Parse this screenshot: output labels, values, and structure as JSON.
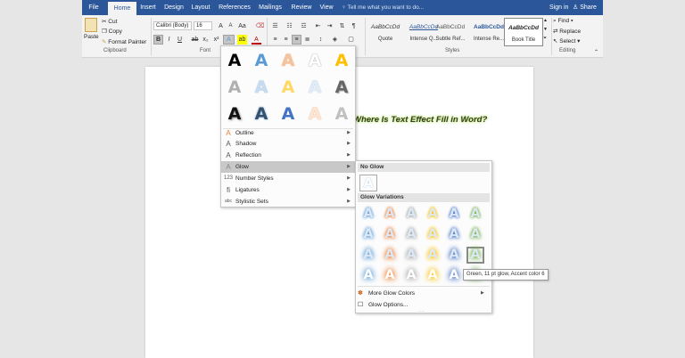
{
  "tabs": [
    "File",
    "Home",
    "Insert",
    "Design",
    "Layout",
    "References",
    "Mailings",
    "Review",
    "View"
  ],
  "tell_me": "Tell me what you want to do...",
  "sign_in": "Sign in",
  "share": "Share",
  "clipboard": {
    "paste": "Paste",
    "cut": "Cut",
    "copy": "Copy",
    "format_painter": "Format Painter",
    "label": "Clipboard"
  },
  "font": {
    "name": "Calibri (Body)",
    "size": "16",
    "label": "Font"
  },
  "styles": {
    "items": [
      {
        "sample": "AaBbCcDd",
        "name": "Quote"
      },
      {
        "sample": "AaBbCcDd",
        "name": "Intense Q..."
      },
      {
        "sample": "AaBbCcDd",
        "name": "Subtle Ref..."
      },
      {
        "sample": "AaBbCcDd",
        "name": "Intense Re..."
      },
      {
        "sample": "AaBbCcDd",
        "name": "Book Title"
      }
    ],
    "label": "Styles"
  },
  "editing": {
    "find": "Find",
    "replace": "Replace",
    "select": "Select",
    "label": "Editing"
  },
  "document": {
    "title": "Where Is Text Effect Fill in Word?"
  },
  "effects_menu": {
    "glyph": "A",
    "items": [
      "Outline",
      "Shadow",
      "Reflection",
      "Glow",
      "Number Styles",
      "Ligatures",
      "Stylistic Sets"
    ]
  },
  "glow_menu": {
    "no_glow": "No Glow",
    "variations": "Glow Variations",
    "more_colors": "More Glow Colors",
    "options": "Glow Options...",
    "tooltip": "Green, 11 pt glow, Accent color 6",
    "accent_colors": [
      "#5b9bd5",
      "#ed7d31",
      "#a5a5a5",
      "#ffc000",
      "#4472c4",
      "#70ad47"
    ]
  }
}
